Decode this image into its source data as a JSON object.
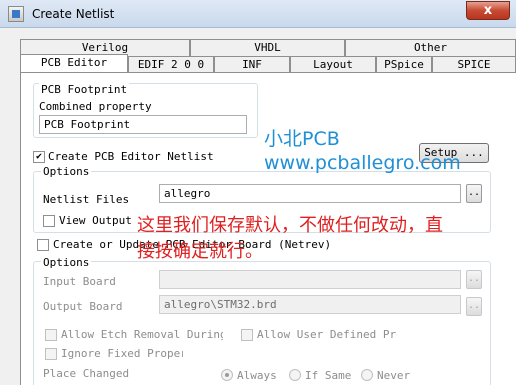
{
  "window": {
    "title": "Create Netlist",
    "close_glyph": "x"
  },
  "tabs_back": [
    {
      "label": "Verilog"
    },
    {
      "label": "VHDL"
    },
    {
      "label": "Other"
    }
  ],
  "tabs_front": [
    {
      "label": "PCB Editor",
      "active": true
    },
    {
      "label": "EDIF 2 0 0"
    },
    {
      "label": "INF"
    },
    {
      "label": "Layout"
    },
    {
      "label": "PSpice"
    },
    {
      "label": "SPICE"
    }
  ],
  "pcb_footprint": {
    "group_title": "PCB Footprint",
    "combined_label": "Combined property",
    "value": "PCB Footprint"
  },
  "create_netlist": {
    "checkbox_label": "Create PCB Editor Netlist",
    "checked": true,
    "setup_button": "Setup ...",
    "options_title": "Options",
    "files_label": "Netlist Files",
    "files_value": "allegro",
    "browse": "..",
    "view_output_label": "View Output",
    "view_output_checked": false
  },
  "update_board": {
    "checkbox_label": "Create or Update PCB Editor Board (Netrev)",
    "checked": false,
    "options_title": "Options",
    "input_board_label": "Input Board",
    "input_board_value": "",
    "output_board_label": "Output Board",
    "output_board_value": "allegro\\STM32.brd",
    "browse": "..",
    "allow_etch_label": "Allow Etch Removal During EC",
    "allow_user_props_label": "Allow User Defined Props",
    "ignore_fixed_label": "Ignore Fixed Property",
    "place_changed_label": "Place Changed",
    "place_options": [
      {
        "label": "Always",
        "checked": true
      },
      {
        "label": "If Same",
        "checked": false
      },
      {
        "label": "Never",
        "checked": false
      }
    ]
  },
  "overlay": {
    "brand": "小北PCB",
    "url": "www.pcballegro.com",
    "note_line1": "这里我们保存默认，不做任何改动，直",
    "note_line2": "接按确定就行。"
  },
  "colors": {
    "overlay_blue": "#1f8fd6",
    "overlay_red": "#e02020",
    "close_red": "#c74a34"
  }
}
